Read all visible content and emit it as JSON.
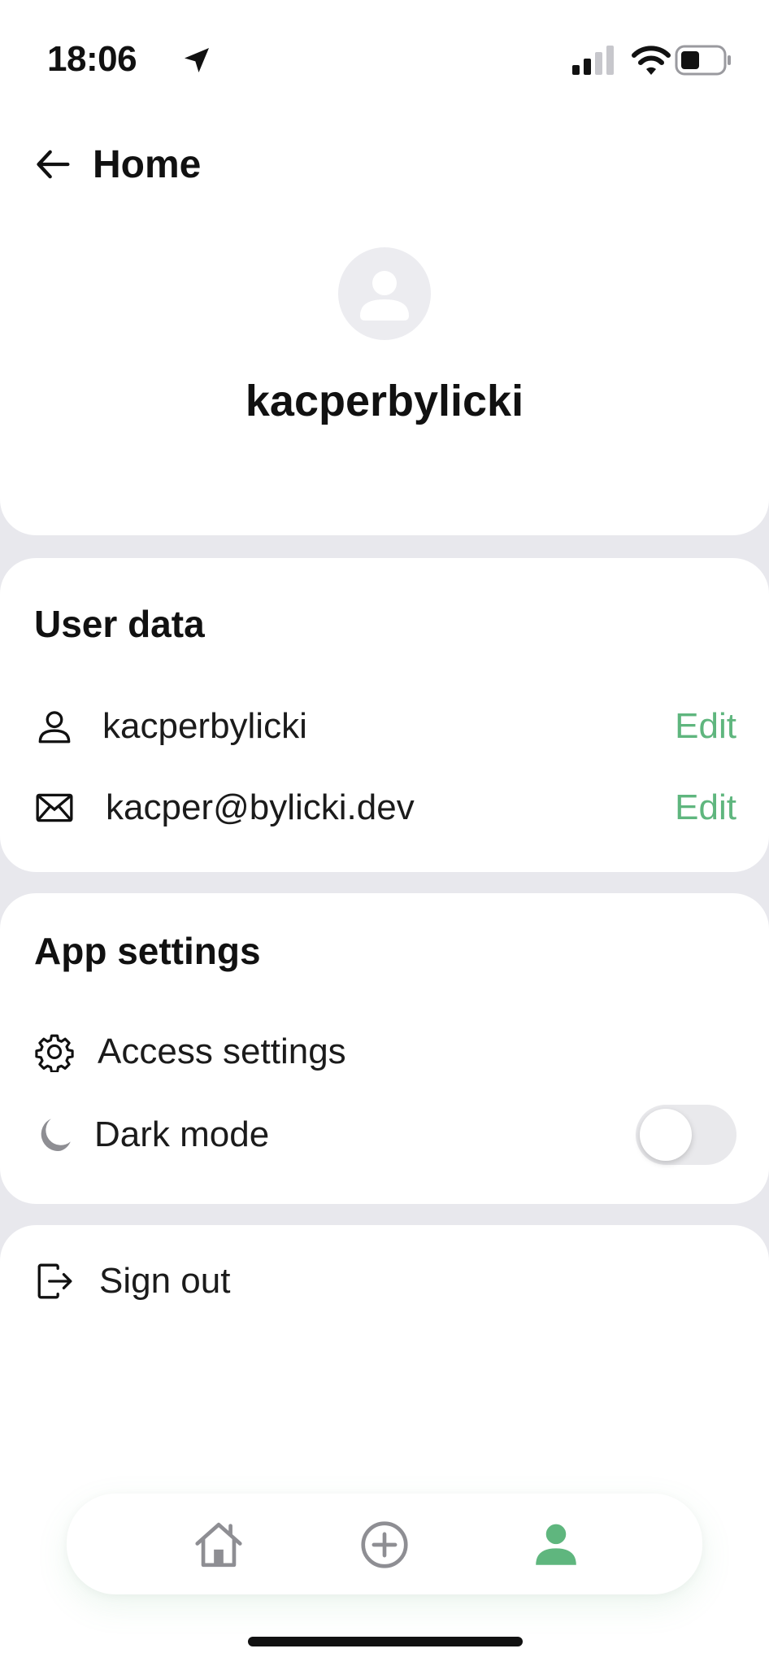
{
  "status_bar": {
    "time": "18:06"
  },
  "header": {
    "back_label": "Home"
  },
  "profile": {
    "username": "kacperbylicki"
  },
  "user_data": {
    "title": "User data",
    "rows": [
      {
        "value": "kacperbylicki",
        "action": "Edit"
      },
      {
        "value": "kacper@bylicki.dev",
        "action": "Edit"
      }
    ]
  },
  "app_settings": {
    "title": "App settings",
    "access_label": "Access settings",
    "dark_mode_label": "Dark mode",
    "dark_mode_on": false
  },
  "sign_out": {
    "label": "Sign out"
  },
  "colors": {
    "accent": "#5fb67e",
    "background": "#e8e8ed",
    "icon_gray": "#8e8e93"
  },
  "tabbar": {
    "items": [
      "home-icon",
      "add-circle-icon",
      "profile-icon"
    ],
    "active": "profile-icon"
  }
}
